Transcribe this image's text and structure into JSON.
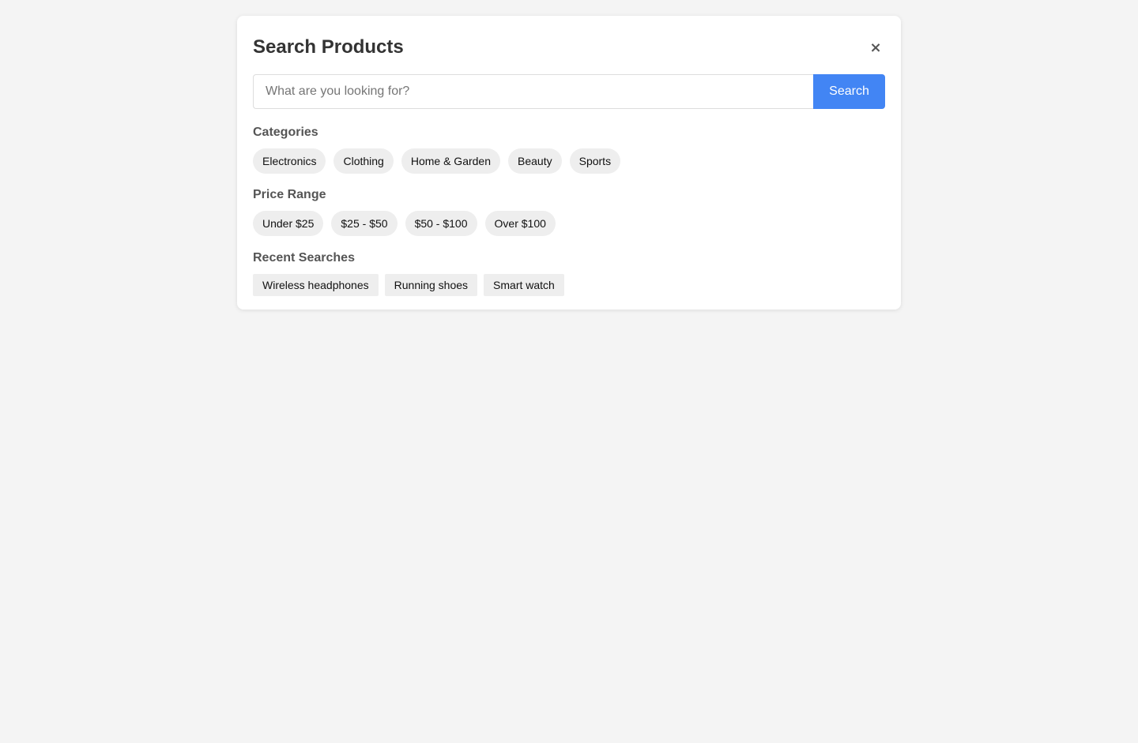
{
  "panel": {
    "title": "Search Products",
    "close_icon": "close-icon",
    "close_glyph": "×"
  },
  "search": {
    "placeholder": "What are you looking for?",
    "value": "",
    "button_label": "Search"
  },
  "categories": {
    "title": "Categories",
    "items": [
      "Electronics",
      "Clothing",
      "Home & Garden",
      "Beauty",
      "Sports"
    ]
  },
  "price_range": {
    "title": "Price Range",
    "items": [
      "Under $25",
      "$25 - $50",
      "$50 - $100",
      "Over $100"
    ]
  },
  "recent_searches": {
    "title": "Recent Searches",
    "items": [
      "Wireless headphones",
      "Running shoes",
      "Smart watch"
    ]
  },
  "colors": {
    "accent": "#4285f4",
    "background": "#f4f4f4",
    "chip": "#eeeeee"
  }
}
